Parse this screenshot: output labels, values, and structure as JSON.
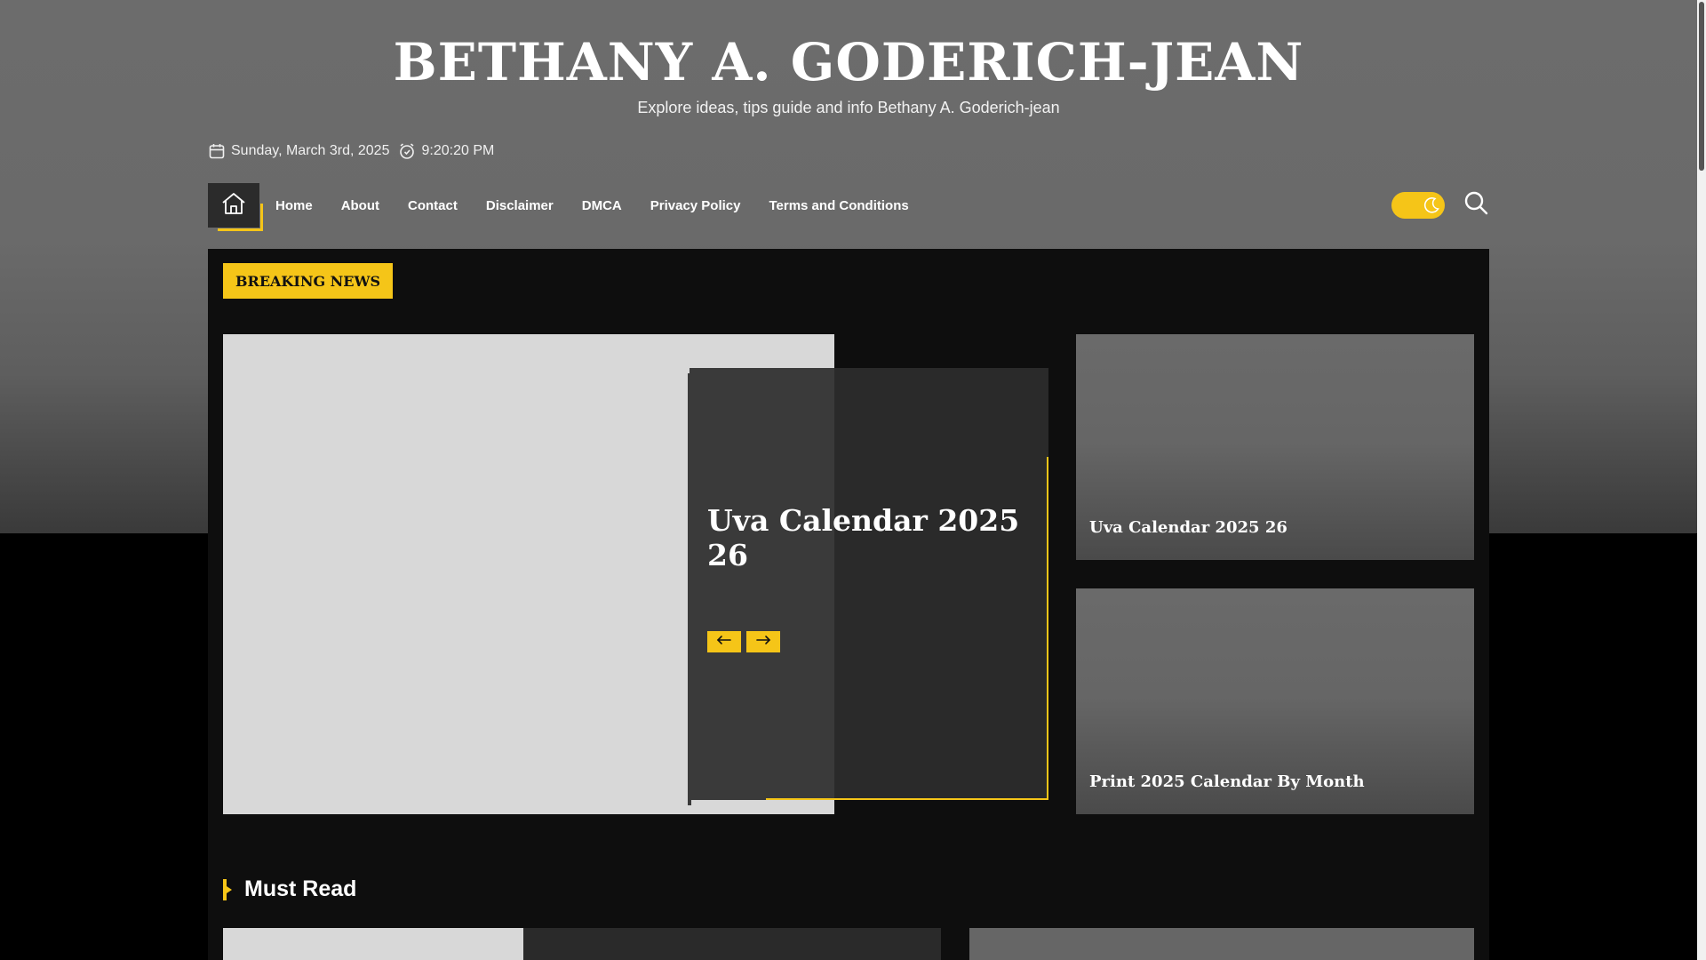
{
  "site": {
    "title": "BETHANY A. GODERICH-JEAN",
    "tagline": "Explore ideas, tips guide and info Bethany A. Goderich-jean"
  },
  "meta": {
    "date": "Sunday, March 3rd, 2025",
    "time": "9:20:20 PM",
    "date_icon": "calendar-icon",
    "time_icon": "clock-icon"
  },
  "nav": {
    "home_icon": "home-icon",
    "items": [
      "Home",
      "About",
      "Contact",
      "Disclaimer",
      "DMCA",
      "Privacy Policy",
      "Terms and Conditions"
    ],
    "theme_toggle_icon": "moon-icon",
    "search_icon": "search-icon"
  },
  "breaking": {
    "label": "BREAKING NEWS",
    "slide_title": "Uva Calendar 2025 26",
    "prev_icon": "arrow-left-icon",
    "next_icon": "arrow-right-icon",
    "side": [
      {
        "title": "Uva Calendar 2025 26"
      },
      {
        "title": "Print 2025 Calendar By Month"
      }
    ]
  },
  "must_read": {
    "heading": "Must Read"
  },
  "colors": {
    "accent": "#f5c518",
    "panel": "#0e0e0e",
    "header_bg": "#6a6a6a"
  }
}
